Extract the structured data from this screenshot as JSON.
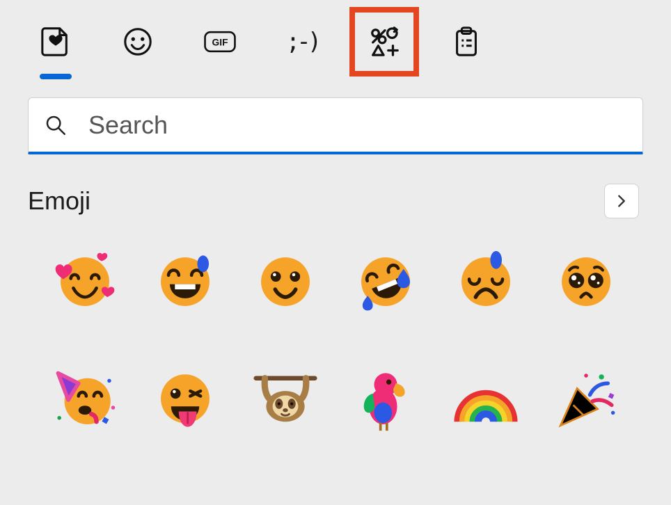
{
  "tabs": {
    "items": [
      {
        "id": "favorites",
        "label": "Most recently used",
        "icon": "heart-tray-icon",
        "active": true
      },
      {
        "id": "emoji",
        "label": "Emoji",
        "icon": "smiley-icon",
        "active": false
      },
      {
        "id": "gif",
        "label": "GIF",
        "icon": "gif-icon",
        "active": false
      },
      {
        "id": "kaomoji",
        "label": "Kaomoji",
        "icon": "kaomoji-icon",
        "active": false,
        "text": ";-)"
      },
      {
        "id": "symbols",
        "label": "Symbols",
        "icon": "symbols-icon",
        "active": false,
        "highlighted": true
      },
      {
        "id": "clipboard",
        "label": "Clipboard history",
        "icon": "clipboard-icon",
        "active": false
      }
    ]
  },
  "search": {
    "placeholder": "Search",
    "value": ""
  },
  "section": {
    "title": "Emoji"
  },
  "emoji_grid": {
    "items": [
      {
        "name": "smiling-face-with-hearts",
        "glyph": "🥰"
      },
      {
        "name": "grinning-face-with-sweat",
        "glyph": "😅"
      },
      {
        "name": "grinning-face-with-big-eyes",
        "glyph": "😃"
      },
      {
        "name": "rolling-on-the-floor-laughing",
        "glyph": "🤣"
      },
      {
        "name": "downcast-face-with-sweat",
        "glyph": "😓"
      },
      {
        "name": "pleading-face",
        "glyph": "🥺"
      },
      {
        "name": "partying-face",
        "glyph": "🥳"
      },
      {
        "name": "winking-face-with-tongue",
        "glyph": "😜"
      },
      {
        "name": "sloth",
        "glyph": "🦥"
      },
      {
        "name": "parrot",
        "glyph": "🦜"
      },
      {
        "name": "rainbow",
        "glyph": "🌈"
      },
      {
        "name": "party-popper",
        "glyph": "🎉"
      }
    ]
  },
  "colors": {
    "accent": "#0566d6",
    "highlight": "#e4471f",
    "emoji_face": "#f6a32a",
    "emoji_face_dark": "#e0921e"
  }
}
